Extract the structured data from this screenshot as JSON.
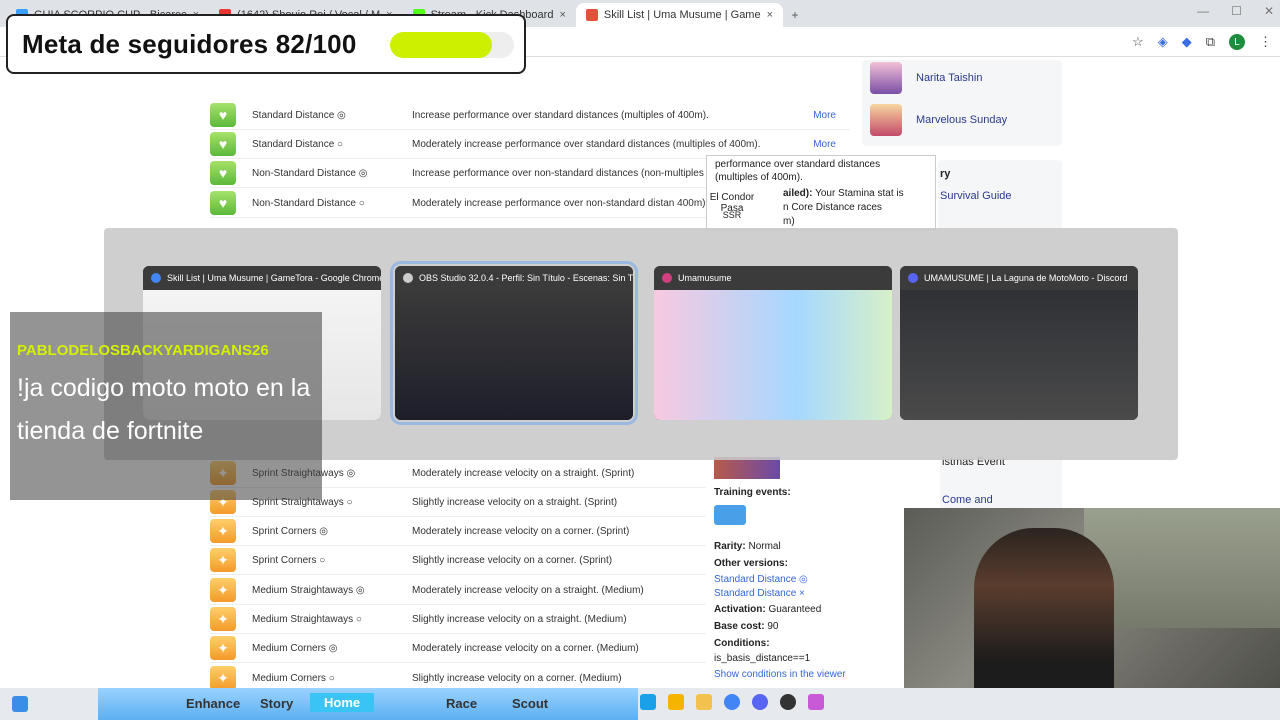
{
  "browser": {
    "tabs": [
      {
        "label": "GUIA SCORPIO CUP - Bicarec"
      },
      {
        "label": "(1642) Shoujo Rei / Vocal / M"
      },
      {
        "label": "Stream - Kick Dashboard"
      },
      {
        "label": "Skill List | Uma Musume | Game"
      }
    ]
  },
  "skills": [
    {
      "name": "Standard Distance ◎",
      "desc": "Increase performance over standard distances (multiples of 400m).",
      "more": "More",
      "color": "green"
    },
    {
      "name": "Standard Distance ○",
      "desc": "Moderately increase performance over standard distances (multiples of 400m).",
      "more": "More",
      "color": "green"
    },
    {
      "name": "Non-Standard Distance ◎",
      "desc": "Increase performance over non-standard distances (non-multiples",
      "more": "",
      "color": "green"
    },
    {
      "name": "Non-Standard Distance ○",
      "desc": "Moderately increase performance over non-standard distan 400m).",
      "more": "",
      "color": "green"
    },
    {
      "name": "Sprint Straightaways ◎",
      "desc": "Moderately increase velocity on a straight. (Sprint)",
      "more": "",
      "color": "orange"
    },
    {
      "name": "Sprint Straightaways ○",
      "desc": "Slightly increase velocity on a straight. (Sprint)",
      "more": "",
      "color": "orange"
    },
    {
      "name": "Sprint Corners ◎",
      "desc": "Moderately increase velocity on a corner. (Sprint)",
      "more": "",
      "color": "orange"
    },
    {
      "name": "Sprint Corners ○",
      "desc": "Slightly increase velocity on a corner. (Sprint)",
      "more": "",
      "color": "orange"
    },
    {
      "name": "Medium Straightaways ◎",
      "desc": "Moderately increase velocity on a straight. (Medium)",
      "more": "",
      "color": "orange"
    },
    {
      "name": "Medium Straightaways ○",
      "desc": "Slightly increase velocity on a straight. (Medium)",
      "more": "",
      "color": "orange"
    },
    {
      "name": "Medium Corners ◎",
      "desc": "Moderately increase velocity on a corner. (Medium)",
      "more": "",
      "color": "orange"
    },
    {
      "name": "Medium Corners ○",
      "desc": "Slightly increase velocity on a corner. (Medium)",
      "more": "",
      "color": "orange"
    }
  ],
  "sidebar": {
    "characters": [
      "Narita Taishin",
      "Marvelous Sunday"
    ],
    "section_fragment": "ry",
    "guide_link": "Survival Guide",
    "event_fragment": "istmas Event",
    "come_and": "Come and"
  },
  "tooltip": {
    "line1": "performance over standard distances",
    "line2": "(multiples of 400m).",
    "card_name": "El Condor Pasa",
    "card_rarity": "SSR",
    "detail_label": "ailed):",
    "detail_text": "Your Stamina stat is",
    "detail_text2": "n Core Distance races",
    "detail_text3": "m)"
  },
  "skill_detail": {
    "training_events_label": "Training events:",
    "rarity_label": "Rarity:",
    "rarity_value": "Normal",
    "other_versions_label": "Other versions:",
    "other_versions": [
      "Standard Distance ◎",
      "Standard Distance ×"
    ],
    "activation_label": "Activation:",
    "activation_value": "Guaranteed",
    "base_cost_label": "Base cost:",
    "base_cost_value": "90",
    "conditions_label": "Conditions:",
    "conditions_value": "is_basis_distance==1",
    "show_conditions": "Show conditions in the viewer"
  },
  "switcher": {
    "windows": [
      {
        "title": "Skill List | Uma Musume | GameTora - Google Chrome",
        "icon_color": "#4285f4",
        "selected": false
      },
      {
        "title": "OBS Studio 32.0.4 - Perfil: Sin Título - Escenas: Sin Título",
        "icon_color": "#cccccc",
        "selected": true
      },
      {
        "title": "Umamusume",
        "icon_color": "#d04080",
        "selected": false
      },
      {
        "title": "UMAMUSUME | La Laguna de MotoMoto - Discord",
        "icon_color": "#5865f2",
        "selected": false
      }
    ]
  },
  "overlay": {
    "goal_text": "Meta de seguidores 82/100",
    "goal_current": 82,
    "goal_target": 100,
    "chat_user": "PABLODELOSBACKYARDIGANS26",
    "chat_message": "!ja codigo moto moto en la tienda de fortnite"
  },
  "game_tabs": [
    "Enhance",
    "Story",
    "Home",
    "Race",
    "Scout"
  ],
  "colors": {
    "goal_fill": "#ccf000",
    "chat_user": "#d4f000",
    "link": "#3367d6"
  }
}
